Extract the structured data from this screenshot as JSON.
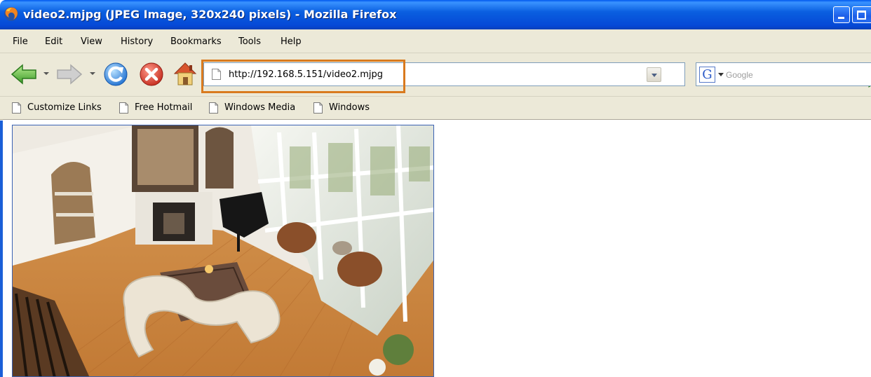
{
  "window": {
    "title": "video2.mjpg (JPEG Image, 320x240 pixels) - Mozilla Firefox"
  },
  "menu": {
    "items": [
      "File",
      "Edit",
      "View",
      "History",
      "Bookmarks",
      "Tools",
      "Help"
    ]
  },
  "navigation": {
    "url": "http://192.168.5.151/video2.mjpg",
    "search_placeholder": "Google",
    "search_engine_letter": "G"
  },
  "bookmarks": {
    "items": [
      "Customize Links",
      "Free Hotmail",
      "Windows Media",
      "Windows"
    ]
  },
  "colors": {
    "titlebar": "#0a5fe0",
    "chrome": "#ece9d8",
    "url_highlight": "#d97a1e"
  }
}
